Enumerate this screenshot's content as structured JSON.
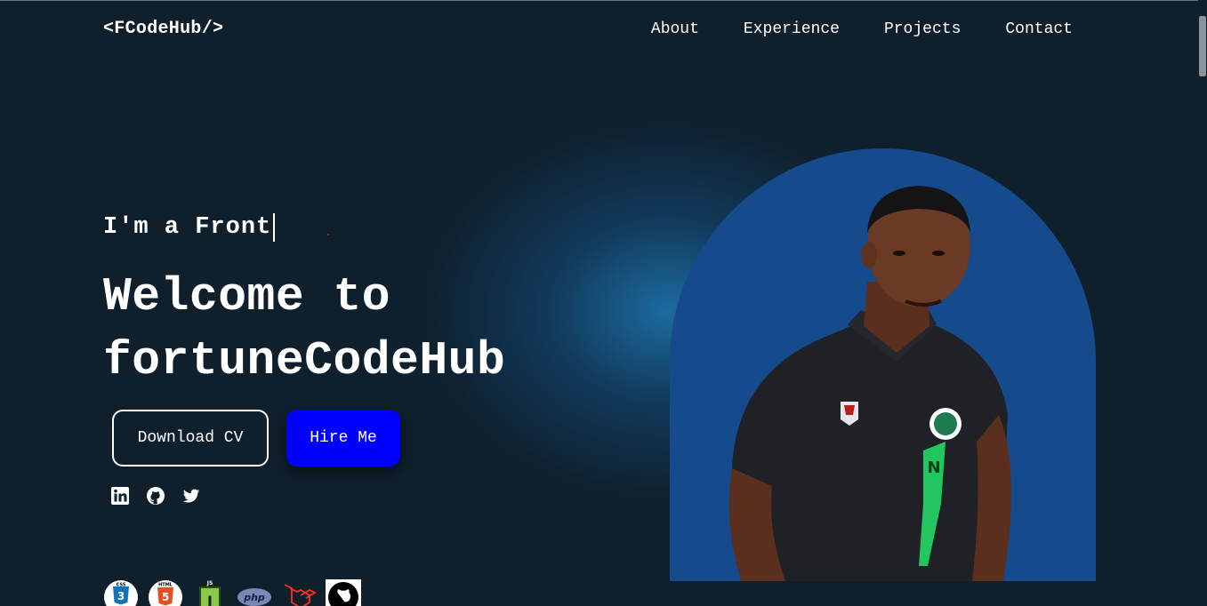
{
  "header": {
    "logo": "<FCodeHub/>",
    "nav": [
      {
        "label": "About"
      },
      {
        "label": "Experience"
      },
      {
        "label": "Projects"
      },
      {
        "label": "Contact"
      }
    ]
  },
  "hero": {
    "typing_text": "I'm a Front",
    "headline": "Welcome to fortuneCodeHub",
    "buttons": {
      "download_cv": "Download CV",
      "hire_me": "Hire Me"
    },
    "socials": [
      "linkedin-icon",
      "github-icon",
      "twitter-icon"
    ],
    "tech_icons": [
      "css3-icon",
      "html5-icon",
      "javascript-icon",
      "php-icon",
      "laravel-icon",
      "github-icon"
    ],
    "tech_labels": {
      "css": "CSS",
      "html": "HTML",
      "js": "JS",
      "php": "php"
    }
  },
  "colors": {
    "background": "#0f1f2c",
    "photo_bg": "#154a8c",
    "hire_button": "#0000ff"
  }
}
